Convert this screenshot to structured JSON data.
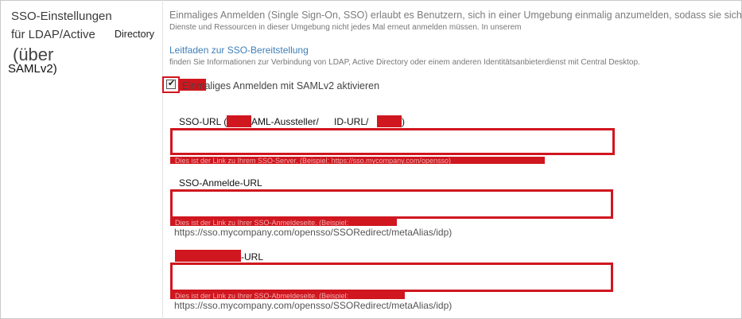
{
  "left_panel": {
    "title_line1": "SSO-Einstellungen",
    "title_line2": "für LDAP/Active",
    "title_directory": "Directory",
    "title_line3": "(über",
    "title_line4": "SAMLv2)"
  },
  "main": {
    "description": "Einmaliges Anmelden (Single Sign-On, SSO) erlaubt es Benutzern, sich in einer Umgebung einmalig anzumelden, sodass sie sich",
    "description_line2": "Dienste und Ressourcen in dieser Umgebung nicht jedes Mal erneut anmelden müssen. In unserem",
    "guide_link": "Leitfaden zur SSO-Bereitstellung",
    "guide_desc": "finden Sie Informationen zur Verbindung von LDAP, Active Directory oder einem anderen Identitätsanbieterdienst mit Central Desktop.",
    "checkbox_label": "Einmaliges Anmelden mit SAMLv2 aktivieren",
    "checkbox_checked": true
  },
  "fields": {
    "sso_url": {
      "label_a": "SSO-URL (",
      "label_b": "AML-Aussteller/",
      "label_c": "ID-URL/",
      "label_d": ")",
      "value": "",
      "hint": "Dies ist der Link zu Ihrem SSO-Server. (Beispiel: https://sso.mycompany.com/opensso)"
    },
    "login_url": {
      "label": "SSO-Anmelde-URL",
      "value": "",
      "hint": "Dies ist der Link zu Ihrer SSO-Anmeldeseite. (Beispiel:",
      "example": "https://sso.mycompany.com/opensso/SSORedirect/metaAlias/idp)"
    },
    "logout_url": {
      "label": "-URL",
      "value": "",
      "hint": "Dies ist der Link zu Ihrer SSO-Abmeldeseite. (Beispiel:",
      "example": "https://sso.mycompany.com/opensso/SSORedirect/metaAlias/idp)"
    }
  },
  "colors": {
    "redaction": "#d0161f",
    "link": "#3d7fb8"
  }
}
